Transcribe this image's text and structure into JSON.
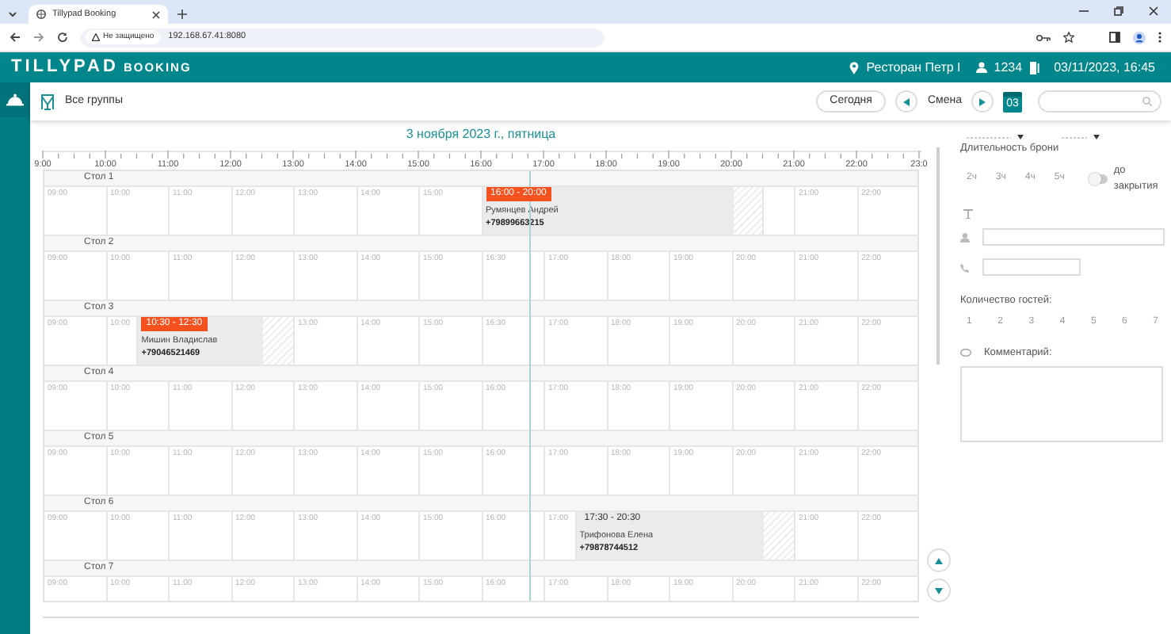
{
  "browser": {
    "tab_title": "Tillypad Booking",
    "security": "Не защищено",
    "url": "192.168.67.41:8080"
  },
  "app_header": {
    "logo": "TILLYPAD",
    "logo_sub": "BOOKING",
    "restaurant": "Ресторан Петр I",
    "user": "1234",
    "datetime": "03/11/2023, 16:45"
  },
  "toolbar": {
    "group": "Все группы",
    "today": "Сегодня",
    "shift": "Смена",
    "calendar_day": "03"
  },
  "schedule": {
    "date": "3 ноября 2023 г., пятница",
    "ruler": [
      "9:00",
      "10:00",
      "11:00",
      "12:00",
      "13:00",
      "14:00",
      "15:00",
      "16:00",
      "17:00",
      "18:00",
      "19:00",
      "20:00",
      "21:00",
      "22:00",
      "23:0"
    ],
    "tables": [
      {
        "name": "Стол 1",
        "segments": [
          {
            "kind": "slot",
            "label": "09:00"
          },
          {
            "kind": "slot",
            "label": "10:00"
          },
          {
            "kind": "slot",
            "label": "11:00"
          },
          {
            "kind": "slot",
            "label": "12:00"
          },
          {
            "kind": "slot",
            "label": "13:00"
          },
          {
            "kind": "slot",
            "label": "14:00"
          },
          {
            "kind": "slot",
            "label": "15:00"
          },
          {
            "kind": "booking",
            "time": "16:00 - 20:00",
            "highlighted": true,
            "guest": "Румянцев Андрей",
            "phone": "+79899663215"
          },
          {
            "kind": "buffer"
          },
          {
            "kind": "blank"
          },
          {
            "kind": "slot",
            "label": "21:00"
          },
          {
            "kind": "slot",
            "label": "22:00"
          }
        ]
      },
      {
        "name": "Стол 2",
        "segments": [
          {
            "kind": "slot",
            "label": "09:00"
          },
          {
            "kind": "slot",
            "label": "10:00"
          },
          {
            "kind": "slot",
            "label": "11:00"
          },
          {
            "kind": "slot",
            "label": "12:00"
          },
          {
            "kind": "slot",
            "label": "13:00"
          },
          {
            "kind": "slot",
            "label": "14:00"
          },
          {
            "kind": "slot",
            "label": "15:00"
          },
          {
            "kind": "slot",
            "label": "16:30"
          },
          {
            "kind": "slot",
            "label": "17:00"
          },
          {
            "kind": "slot",
            "label": "18:00"
          },
          {
            "kind": "slot",
            "label": "19:00"
          },
          {
            "kind": "slot",
            "label": "20:00"
          },
          {
            "kind": "slot",
            "label": "21:00"
          },
          {
            "kind": "slot",
            "label": "22:00"
          }
        ]
      },
      {
        "name": "Стол 3",
        "segments": [
          {
            "kind": "slot",
            "label": "09:00"
          },
          {
            "kind": "slot",
            "label": "10:00"
          },
          {
            "kind": "booking",
            "time": "10:30 - 12:30",
            "highlighted": true,
            "guest": "Мишин Владислав",
            "phone": "+79046521469"
          },
          {
            "kind": "buffer"
          },
          {
            "kind": "slot",
            "label": "13:00"
          },
          {
            "kind": "slot",
            "label": "14:00"
          },
          {
            "kind": "slot",
            "label": "15:00"
          },
          {
            "kind": "slot",
            "label": "16:30"
          },
          {
            "kind": "slot",
            "label": "17:00"
          },
          {
            "kind": "slot",
            "label": "18:00"
          },
          {
            "kind": "slot",
            "label": "19:00"
          },
          {
            "kind": "slot",
            "label": "20:00"
          },
          {
            "kind": "slot",
            "label": "21:00"
          },
          {
            "kind": "slot",
            "label": "22:00"
          }
        ]
      },
      {
        "name": "Стол 4",
        "segments": [
          {
            "kind": "slot",
            "label": "09:00"
          },
          {
            "kind": "slot",
            "label": "10:00"
          },
          {
            "kind": "slot",
            "label": "11:00"
          },
          {
            "kind": "slot",
            "label": "12:00"
          },
          {
            "kind": "slot",
            "label": "13:00"
          },
          {
            "kind": "slot",
            "label": "14:00"
          },
          {
            "kind": "slot",
            "label": "15:00"
          },
          {
            "kind": "slot",
            "label": "16:00"
          },
          {
            "kind": "slot",
            "label": "17:00"
          },
          {
            "kind": "slot",
            "label": "18:00"
          },
          {
            "kind": "slot",
            "label": "19:00"
          },
          {
            "kind": "slot",
            "label": "20:00"
          },
          {
            "kind": "slot",
            "label": "21:00"
          },
          {
            "kind": "slot",
            "label": "22:00"
          }
        ]
      },
      {
        "name": "Стол 5",
        "segments": [
          {
            "kind": "slot",
            "label": "09:00"
          },
          {
            "kind": "slot",
            "label": "10:00"
          },
          {
            "kind": "slot",
            "label": "11:00"
          },
          {
            "kind": "slot",
            "label": "12:00"
          },
          {
            "kind": "slot",
            "label": "13:00"
          },
          {
            "kind": "slot",
            "label": "14:00"
          },
          {
            "kind": "slot",
            "label": "15:00"
          },
          {
            "kind": "slot",
            "label": "16:00"
          },
          {
            "kind": "slot",
            "label": "17:00"
          },
          {
            "kind": "slot",
            "label": "18:00"
          },
          {
            "kind": "slot",
            "label": "19:00"
          },
          {
            "kind": "slot",
            "label": "20:00"
          },
          {
            "kind": "slot",
            "label": "21:00"
          },
          {
            "kind": "slot",
            "label": "22:00"
          }
        ]
      },
      {
        "name": "Стол 6",
        "segments": [
          {
            "kind": "slot",
            "label": "09:00"
          },
          {
            "kind": "slot",
            "label": "10:00"
          },
          {
            "kind": "slot",
            "label": "11:00"
          },
          {
            "kind": "slot",
            "label": "12:00"
          },
          {
            "kind": "slot",
            "label": "13:00"
          },
          {
            "kind": "slot",
            "label": "14:00"
          },
          {
            "kind": "slot",
            "label": "15:00"
          },
          {
            "kind": "slot",
            "label": "16:00"
          },
          {
            "kind": "slot",
            "label": "17:00"
          },
          {
            "kind": "booking",
            "time": "17:30 - 20:30",
            "highlighted": false,
            "guest": "Трифонова Елена",
            "phone": "+79878744512"
          },
          {
            "kind": "buffer"
          },
          {
            "kind": "slot",
            "label": "21:00"
          },
          {
            "kind": "slot",
            "label": "22:00"
          }
        ]
      },
      {
        "name": "Стол 7",
        "segments": [
          {
            "kind": "slot",
            "label": "09:00"
          },
          {
            "kind": "slot",
            "label": "10:00"
          },
          {
            "kind": "slot",
            "label": "11:00"
          },
          {
            "kind": "slot",
            "label": "12:00"
          },
          {
            "kind": "slot",
            "label": "13:00"
          },
          {
            "kind": "slot",
            "label": "14:00"
          },
          {
            "kind": "slot",
            "label": "15:00"
          },
          {
            "kind": "slot",
            "label": "16:00"
          },
          {
            "kind": "slot",
            "label": "17:00"
          },
          {
            "kind": "slot",
            "label": "18:00"
          },
          {
            "kind": "slot",
            "label": "19:00"
          },
          {
            "kind": "slot",
            "label": "20:00"
          },
          {
            "kind": "slot",
            "label": "21:00"
          },
          {
            "kind": "slot",
            "label": "22:00"
          }
        ]
      }
    ]
  },
  "panel": {
    "duration_label": "Длительность брони",
    "durations": [
      "2ч",
      "3ч",
      "4ч",
      "5ч"
    ],
    "until_closing": {
      "label": "до закрытия",
      "on": false
    },
    "guests_label": "Количество гостей:",
    "guest_counts": [
      "1",
      "2",
      "3",
      "4",
      "5",
      "6",
      "7"
    ],
    "comment_label": "Комментарий:"
  }
}
